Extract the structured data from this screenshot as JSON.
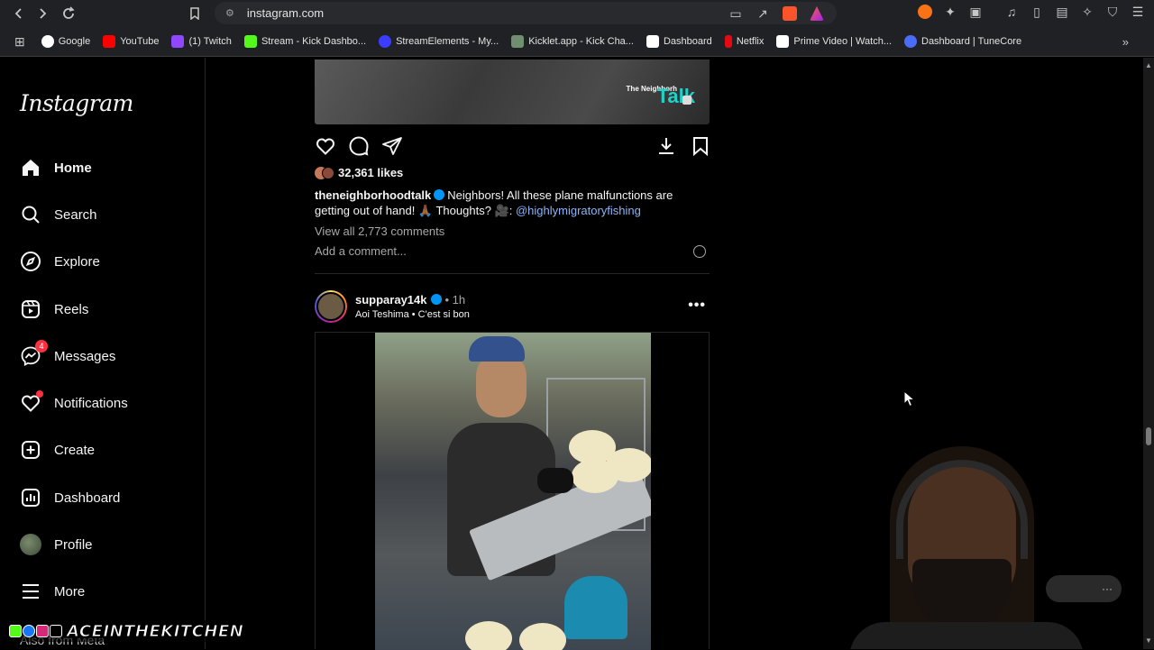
{
  "browser": {
    "url": "instagram.com",
    "bookmarks": [
      {
        "label": "Google",
        "color": "#4285f4"
      },
      {
        "label": "YouTube",
        "color": "#ff0000"
      },
      {
        "label": "(1) Twitch",
        "color": "#9146ff"
      },
      {
        "label": "Stream - Kick Dashbo...",
        "color": "#53fc18"
      },
      {
        "label": "StreamElements - My...",
        "color": "#3c3cff"
      },
      {
        "label": "Kicklet.app - Kick Cha...",
        "color": "#6f8f6f"
      },
      {
        "label": "Dashboard",
        "color": "#ffffff"
      },
      {
        "label": "Netflix",
        "color": "#e50914"
      },
      {
        "label": "Prime Video | Watch...",
        "color": "#ffffff"
      },
      {
        "label": "Dashboard | TuneCore",
        "color": "#4a6cf7"
      }
    ]
  },
  "sidebar": {
    "logo": "Instagram",
    "items": [
      {
        "label": "Home",
        "icon": "home-icon"
      },
      {
        "label": "Search",
        "icon": "search-icon"
      },
      {
        "label": "Explore",
        "icon": "explore-icon"
      },
      {
        "label": "Reels",
        "icon": "reels-icon"
      },
      {
        "label": "Messages",
        "icon": "messages-icon",
        "badge": "4"
      },
      {
        "label": "Notifications",
        "icon": "heart-icon"
      },
      {
        "label": "Create",
        "icon": "plus-icon"
      },
      {
        "label": "Dashboard",
        "icon": "dashboard-icon"
      },
      {
        "label": "Profile",
        "icon": "avatar"
      },
      {
        "label": "More",
        "icon": "menu-icon"
      }
    ],
    "behind_text": "Also from Meta"
  },
  "post1": {
    "likes": "32,361 likes",
    "username": "theneighborhoodtalk",
    "caption": "Neighbors! All these plane malfunctions are getting out of hand! 🙏🏾 Thoughts? 🎥: ",
    "mention": "@highlymigratoryfishing",
    "view_comments": "View all 2,773 comments",
    "add_comment_placeholder": "Add a comment...",
    "video_watermark": "Talk",
    "video_watermark_small": "The Neighborh"
  },
  "post2": {
    "username": "supparay14k",
    "time": "• 1h",
    "audio": "Aoi Teshima • C'est si bon",
    "more": "•••"
  },
  "overlay": {
    "channel_text": "ACEINTHEKITCHEN",
    "pill_text": "···"
  }
}
